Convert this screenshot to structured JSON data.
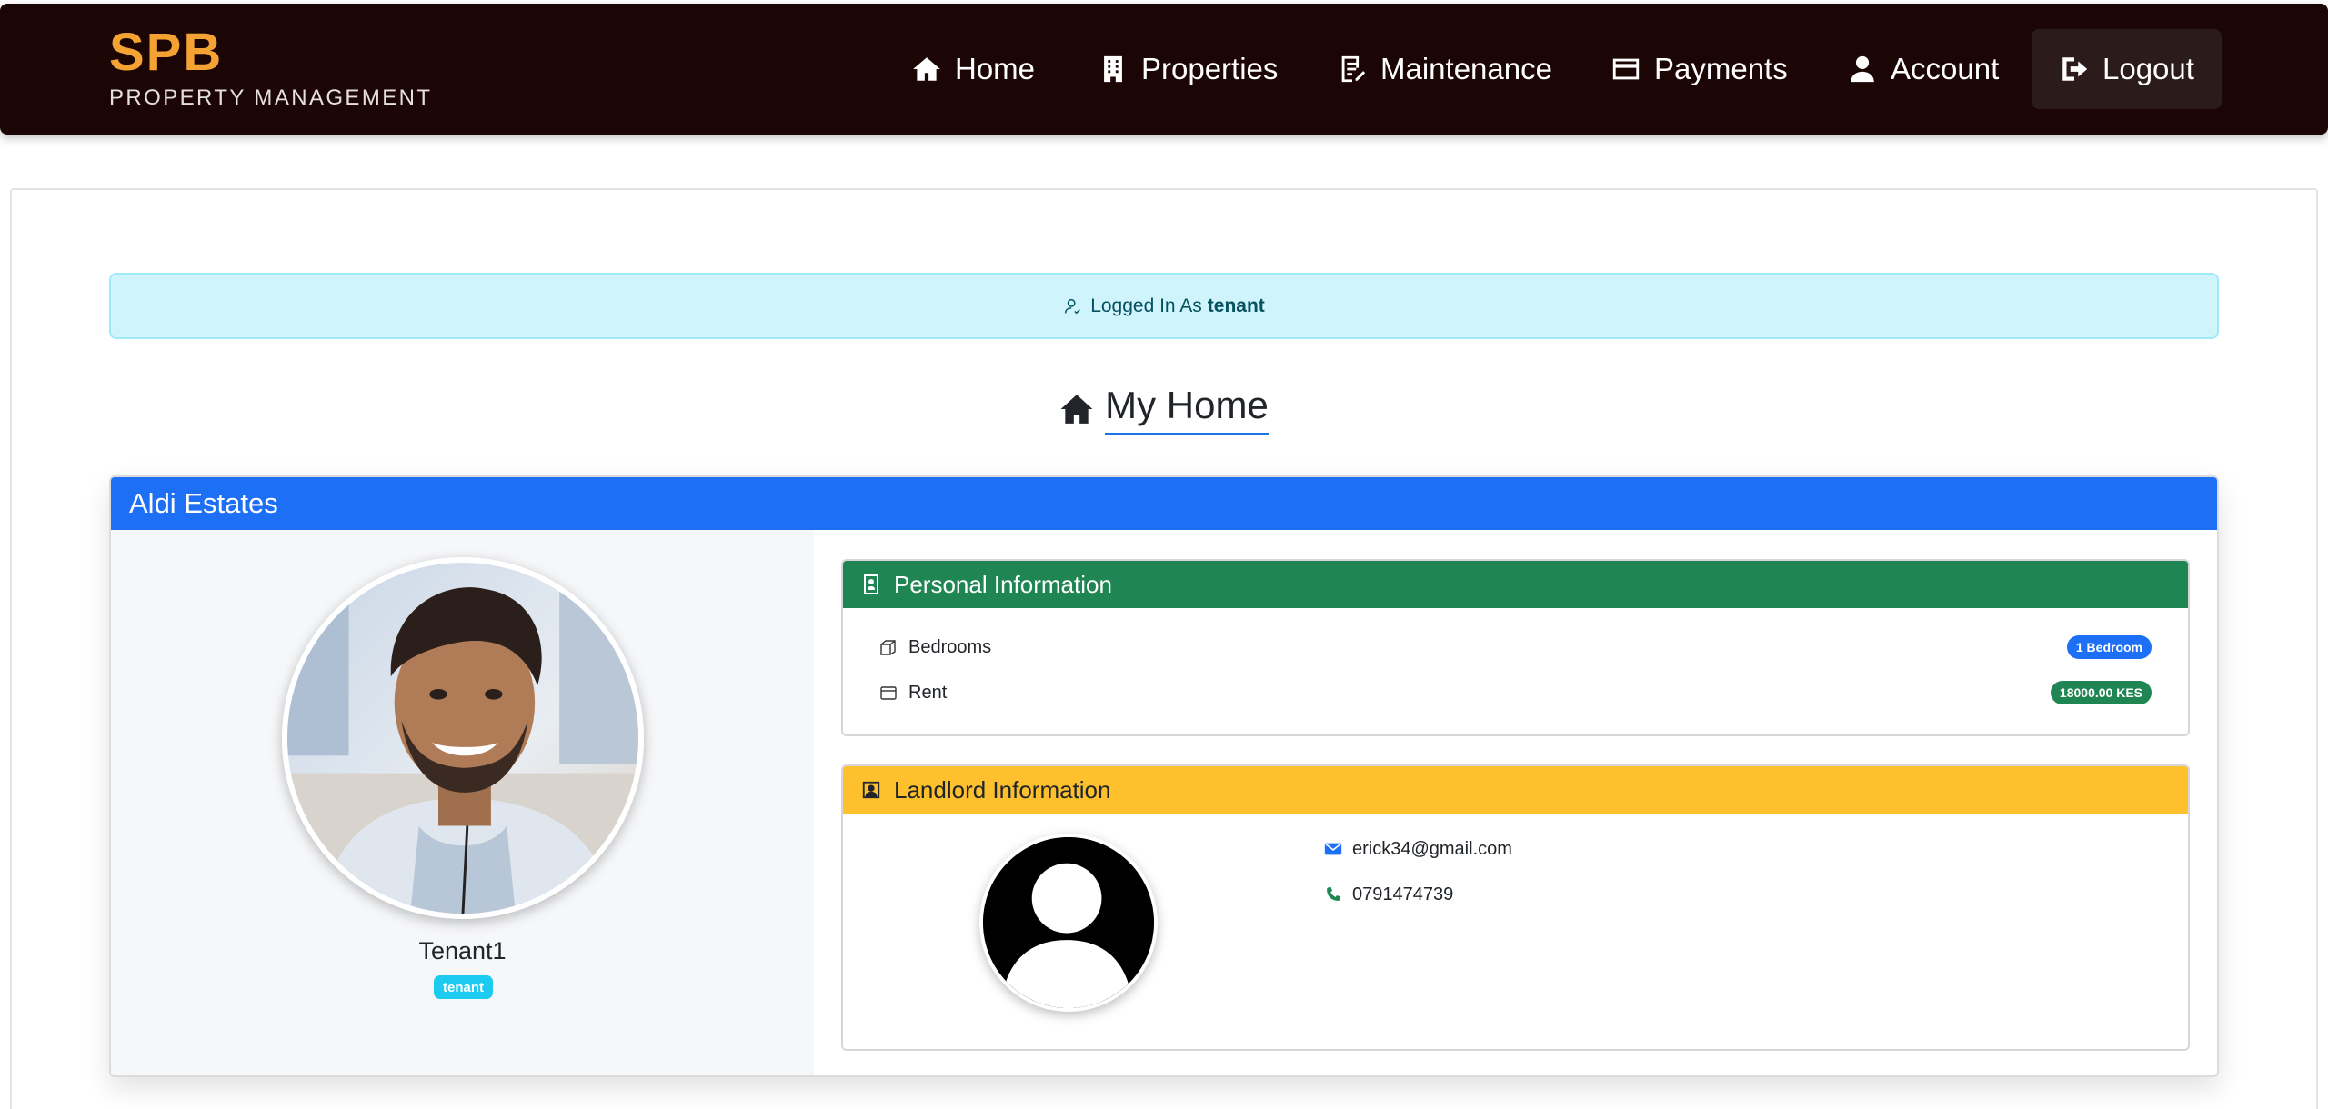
{
  "brand": {
    "title": "SPB",
    "subtitle": "PROPERTY MANAGEMENT",
    "accent": "#f5a234",
    "bar_bg": "#1c0505"
  },
  "nav": {
    "items": [
      {
        "label": "Home",
        "icon": "home-icon"
      },
      {
        "label": "Properties",
        "icon": "building-icon"
      },
      {
        "label": "Maintenance",
        "icon": "clipboard-edit-icon"
      },
      {
        "label": "Payments",
        "icon": "credit-card-icon"
      },
      {
        "label": "Account",
        "icon": "user-icon"
      },
      {
        "label": "Logout",
        "icon": "logout-icon"
      }
    ]
  },
  "alert": {
    "prefix": "Logged In As",
    "role": "tenant",
    "icon": "user-check-icon",
    "bg": "#cff4fc"
  },
  "page": {
    "title": "My Home",
    "icon": "home-icon"
  },
  "property": {
    "name": "Aldi Estates",
    "header_color": "#1d6ff5",
    "tenant": {
      "name": "Tenant1",
      "role_badge": "tenant",
      "avatar": "tenant-photo"
    },
    "personal": {
      "title": "Personal Information",
      "icon": "id-badge-icon",
      "color": "#1f8553",
      "rows": [
        {
          "label": "Bedrooms",
          "value": "1 Bedroom",
          "icon": "rooms-icon"
        },
        {
          "label": "Rent",
          "value": "18000.00 KES",
          "icon": "wallet-icon"
        }
      ]
    },
    "landlord": {
      "title": "Landlord Information",
      "icon": "person-square-icon",
      "color": "#ffc02e",
      "email": "erick34@gmail.com",
      "phone": "0791474739",
      "avatar": "default-avatar"
    }
  }
}
